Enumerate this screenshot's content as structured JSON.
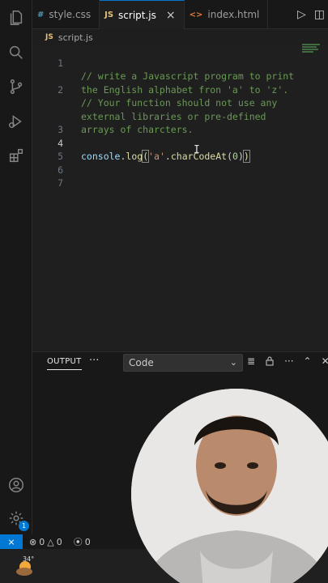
{
  "tabs": [
    {
      "icon": "#",
      "label": "style.css",
      "active": false
    },
    {
      "icon": "JS",
      "label": "script.js",
      "active": true,
      "close": "×"
    },
    {
      "icon": "<>",
      "label": "index.html",
      "active": false
    }
  ],
  "breadcrumb": {
    "icon": "JS",
    "file": "script.js"
  },
  "editor": {
    "lines": [
      {
        "n": "1",
        "text": "// write a Javascript program to print"
      },
      {
        "n": "",
        "text": "the English alphabet fron 'a' to 'z'."
      },
      {
        "n": "2",
        "text": "// Your function should not use any"
      },
      {
        "n": "",
        "text": "external libraries or pre-defined"
      },
      {
        "n": "",
        "text": "arrays of charcters."
      },
      {
        "n": "3",
        "text": ""
      },
      {
        "n": "4",
        "text": "console.log('a'.charCodeAt(0))"
      },
      {
        "n": "5",
        "text": ""
      },
      {
        "n": "6",
        "text": ""
      },
      {
        "n": "7",
        "text": ""
      }
    ],
    "code_tokens": {
      "obj": "console",
      "dot1": ".",
      "fn1": "log",
      "open": "(",
      "str": "'a'",
      "dot2": ".",
      "fn2": "charCodeAt",
      "open2": "(",
      "num": "0",
      "close2": ")",
      "close": ")"
    },
    "cursor_glyph": "I"
  },
  "panel": {
    "title": "OUTPUT",
    "more": "···",
    "select_value": "Code",
    "chevron": "⌄"
  },
  "statusbar": {
    "remote_glyph": "⨯",
    "errors": "0",
    "warnings": "0",
    "ports": "0"
  },
  "taskbar": {
    "temperature": "34°"
  },
  "activity_badge": "1",
  "colors": {
    "accent": "#0078d4",
    "comment": "#6a9955",
    "string": "#ce9178",
    "function": "#dcdcaa",
    "number": "#b5cea8"
  }
}
